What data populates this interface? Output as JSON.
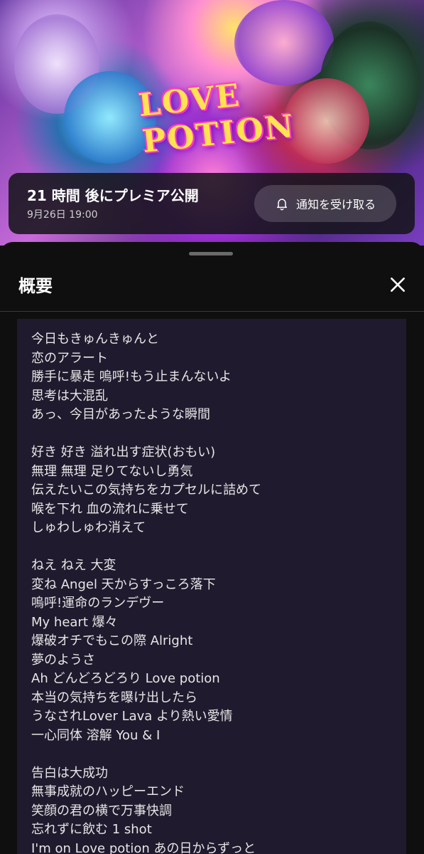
{
  "premiere": {
    "title": "21 時間 後にプレミア公開",
    "date": "9月26日 19:00",
    "notify_label": "通知を受け取る"
  },
  "thumbnail": {
    "logo_text": "LOVE POTION"
  },
  "description": {
    "title": "概要",
    "lines": [
      "今日もきゅんきゅんと",
      "恋のアラート",
      "勝手に暴走 嗚呼!もう止まんないよ",
      "思考は大混乱",
      "あっ、今目があったような瞬間",
      "",
      "好き 好き 溢れ出す症状(おもい)",
      "無理 無理 足りてないし勇気",
      "伝えたいこの気持ちをカプセルに詰めて",
      "喉を下れ 血の流れに乗せて",
      "しゅわしゅわ消えて",
      "",
      "ねえ ねえ 大変",
      "変ね Angel 天からすっころ落下",
      "嗚呼!運命のランデヴー",
      "My heart 爆々",
      "爆破オチでもこの際 Alright",
      "夢のようさ",
      "Ah どんどろどろり Love potion",
      "本当の気持ちを曝け出したら",
      "うなされLover Lava より熱い愛情",
      "一心同体 溶解 You & I",
      "",
      "告白は大成功",
      "無事成就のハッピーエンド",
      "笑顔の君の横で万事快調",
      "忘れずに飲む 1 shot",
      "I'm on Love potion あの日からずっと"
    ]
  },
  "colors": {
    "sheet_bg": "#0f0f0f",
    "lyrics_bg": "#1f1a2e",
    "logo_yellow": "#ffe34f",
    "logo_pink": "#ff3fc8"
  }
}
